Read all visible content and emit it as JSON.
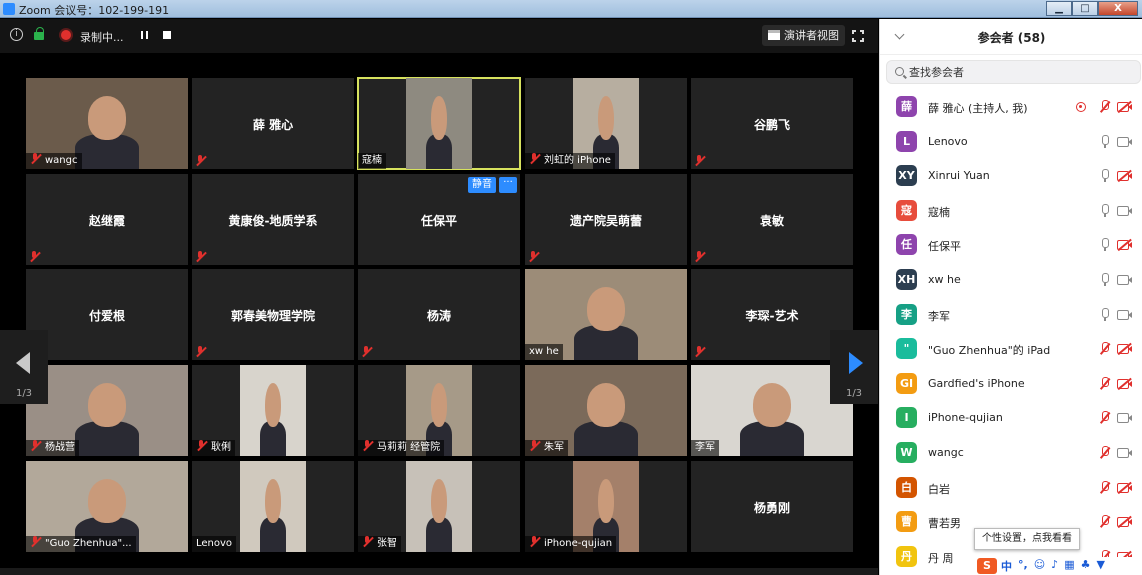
{
  "window": {
    "title": "Zoom 会议号：102-199-191",
    "min": "▁",
    "max": "□",
    "close": "X"
  },
  "topbar": {
    "info_icon": "i",
    "record_label": "录制中...",
    "speaker_view_label": "演讲者视图"
  },
  "tiles": [
    {
      "name": "wangc",
      "video": true,
      "muted": true,
      "bg": "#6b5b4b"
    },
    {
      "name": "薛 雅心",
      "video": false,
      "muted": true
    },
    {
      "name": "寇楠",
      "video": true,
      "muted": false,
      "bg": "#8e8a80",
      "active": true
    },
    {
      "name": "刘虹的 iPhone",
      "video": true,
      "muted": true,
      "bg": "#b7aea0"
    },
    {
      "name": "谷鹏飞",
      "video": false,
      "muted": true
    },
    {
      "name": "赵继霞",
      "video": false,
      "muted": true
    },
    {
      "name": "黄康俊-地质学系",
      "video": false,
      "muted": true
    },
    {
      "name": "任保平",
      "video": false,
      "muted": false
    },
    {
      "name": "遗产院吴萌蕾",
      "video": false,
      "muted": true
    },
    {
      "name": "袁敏",
      "video": false,
      "muted": true
    },
    {
      "name": "付爱根",
      "video": false,
      "muted": true
    },
    {
      "name": "郭春美物理学院",
      "video": false,
      "muted": true
    },
    {
      "name": "杨涛",
      "video": false,
      "muted": true
    },
    {
      "name": "xw he",
      "video": true,
      "muted": false,
      "bg": "#9c8c78"
    },
    {
      "name": "李琛-艺术",
      "video": false,
      "muted": true
    },
    {
      "name": "杨战营",
      "video": true,
      "muted": true,
      "bg": "#9a8f86"
    },
    {
      "name": "耿俐",
      "video": true,
      "muted": true,
      "bg": "#d8d4cc"
    },
    {
      "name": "马莉莉 经管院",
      "video": true,
      "muted": true,
      "bg": "#a69a88"
    },
    {
      "name": "朱军",
      "video": true,
      "muted": true,
      "bg": "#7b6a5a"
    },
    {
      "name": "李军",
      "video": true,
      "muted": false,
      "bg": "#d9d6d0"
    },
    {
      "name": "\"Guo Zhenhua\"...",
      "video": true,
      "muted": true,
      "bg": "#b2a89a"
    },
    {
      "name": "Lenovo",
      "video": true,
      "muted": false,
      "bg": "#d0c9be"
    },
    {
      "name": "张智",
      "video": true,
      "muted": true,
      "bg": "#c7c1b8"
    },
    {
      "name": "iPhone-qujian",
      "video": true,
      "muted": true,
      "bg": "#a4806a"
    },
    {
      "name": "杨勇刚",
      "video": false,
      "muted": false
    }
  ],
  "hover_controls": {
    "mute": "静音",
    "more": "···"
  },
  "pager": {
    "left_page": "1/3",
    "right_page": "1/3"
  },
  "panel": {
    "title": "参会者 (58)",
    "search_placeholder": "查找参会者",
    "participants": [
      {
        "initial": "薛",
        "color": "#8e44ad",
        "name": "薛 雅心 (主持人, 我)",
        "sharing": true,
        "mic": "off",
        "cam": "off"
      },
      {
        "initial": "L",
        "color": "#8e44ad",
        "name": "Lenovo",
        "mic": "on",
        "cam": "on"
      },
      {
        "initial": "XY",
        "color": "#2c3e50",
        "name": "Xinrui Yuan",
        "mic": "on",
        "cam": "off"
      },
      {
        "initial": "寇",
        "color": "#e74c3c",
        "name": "寇楠",
        "mic": "on",
        "cam": "on"
      },
      {
        "initial": "任",
        "color": "#8e44ad",
        "name": "任保平",
        "mic": "on",
        "cam": "off"
      },
      {
        "initial": "XH",
        "color": "#2c3e50",
        "name": "xw he",
        "mic": "on",
        "cam": "on"
      },
      {
        "initial": "李",
        "color": "#16a085",
        "name": "李军",
        "mic": "on",
        "cam": "on"
      },
      {
        "initial": "\"",
        "color": "#1abc9c",
        "name": "\"Guo Zhenhua\"的 iPad",
        "mic": "off",
        "cam": "off"
      },
      {
        "initial": "GI",
        "color": "#f39c12",
        "name": "Gardfied's iPhone",
        "mic": "off",
        "cam": "off"
      },
      {
        "initial": "I",
        "color": "#27ae60",
        "name": "iPhone-qujian",
        "mic": "off",
        "cam": "on"
      },
      {
        "initial": "W",
        "color": "#27ae60",
        "name": "wangc",
        "mic": "off",
        "cam": "on"
      },
      {
        "initial": "白",
        "color": "#d35400",
        "name": "白岩",
        "mic": "off",
        "cam": "off"
      },
      {
        "initial": "曹",
        "color": "#f39c12",
        "name": "曹若男",
        "mic": "off",
        "cam": "off"
      },
      {
        "initial": "丹",
        "color": "#f1c40f",
        "name": "丹 周",
        "mic": "off",
        "cam": "off"
      }
    ]
  },
  "tooltip": "个性设置，点我看看",
  "ime": {
    "logo": "S",
    "items": [
      "中",
      "°,",
      "☺",
      "♪",
      "▦",
      "♣",
      "▼"
    ]
  }
}
